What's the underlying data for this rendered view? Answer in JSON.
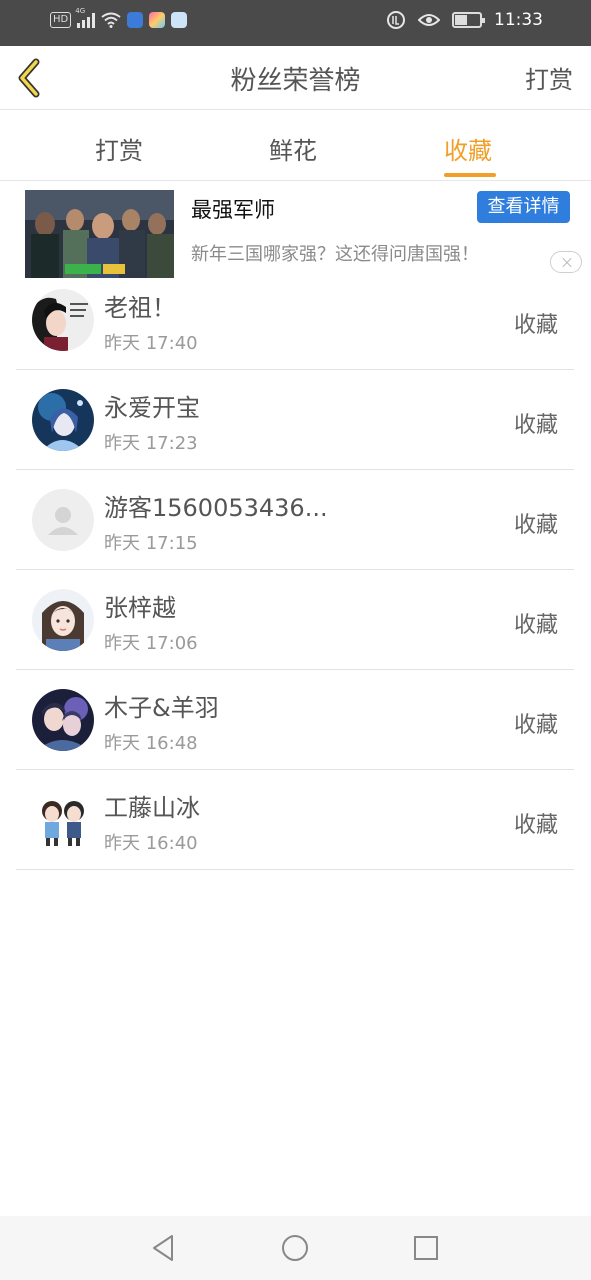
{
  "status_bar": {
    "hd": "HD",
    "network": "4G",
    "time": "11:33"
  },
  "nav": {
    "title": "粉丝荣誉榜",
    "action": "打赏"
  },
  "tabs": [
    {
      "label": "打赏"
    },
    {
      "label": "鲜花"
    },
    {
      "label": "收藏"
    }
  ],
  "active_tab": "收藏",
  "ad": {
    "title": "最强军师",
    "button": "查看详情",
    "description": "新年三国哪家强？这还得问唐国强！"
  },
  "list": [
    {
      "name": "老祖！",
      "time": "昨天 17:40",
      "action": "收藏",
      "avatar": "anime-girl-dark"
    },
    {
      "name": "永爱开宝",
      "time": "昨天 17:23",
      "action": "收藏",
      "avatar": "anime-blue"
    },
    {
      "name": "游客1560053436...",
      "time": "昨天 17:15",
      "action": "收藏",
      "avatar": "default-user"
    },
    {
      "name": "张梓越",
      "time": "昨天 17:06",
      "action": "收藏",
      "avatar": "photo-girl"
    },
    {
      "name": "木子&羊羽",
      "time": "昨天 16:48",
      "action": "收藏",
      "avatar": "anime-couple-dark"
    },
    {
      "name": "工藤山冰",
      "time": "昨天 16:40",
      "action": "收藏",
      "avatar": "chibi-couple"
    }
  ],
  "colors": {
    "accent": "#f0a02a",
    "ad_button": "#2f7ddc",
    "status_bar": "#4a4a4a"
  }
}
